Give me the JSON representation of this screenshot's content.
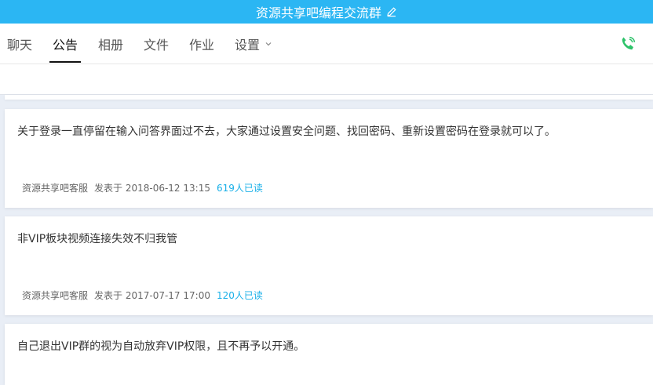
{
  "header": {
    "title": "资源共享吧编程交流群",
    "edit_icon": "edit-pencil-icon"
  },
  "tabs": [
    {
      "label": "聊天",
      "active": false
    },
    {
      "label": "公告",
      "active": true
    },
    {
      "label": "相册",
      "active": false
    },
    {
      "label": "文件",
      "active": false
    },
    {
      "label": "作业",
      "active": false
    },
    {
      "label": "设置",
      "active": false,
      "has_dropdown": true
    }
  ],
  "actions": {
    "phone_icon": "phone-call-icon",
    "phone_color": "#2ec26a"
  },
  "announcements": [
    {
      "content": "关于登录一直停留在输入问答界面过不去，大家通过设置安全问题、找回密码、重新设置密码在登录就可以了。",
      "author": "资源共享吧客服",
      "posted": "发表于 2018-06-12 13:15",
      "reads": "619人已读"
    },
    {
      "content": "非VIP板块视频连接失效不归我管",
      "author": "资源共享吧客服",
      "posted": "发表于 2017-07-17 17:00",
      "reads": "120人已读"
    },
    {
      "content": "自己退出VIP群的视为自动放弃VIP权限，且不再予以开通。",
      "author": "",
      "posted": "",
      "reads": ""
    }
  ],
  "colors": {
    "titlebar": "#2bb6f3",
    "read_count": "#1ab0e8",
    "background": "#e9eef6"
  }
}
